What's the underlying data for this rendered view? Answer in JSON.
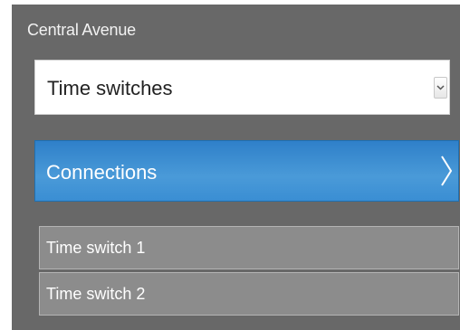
{
  "panel": {
    "title": "Central Avenue"
  },
  "select": {
    "value": "Time switches"
  },
  "connections": {
    "label": "Connections"
  },
  "items": [
    {
      "label": "Time switch 1"
    },
    {
      "label": "Time switch 2"
    }
  ]
}
